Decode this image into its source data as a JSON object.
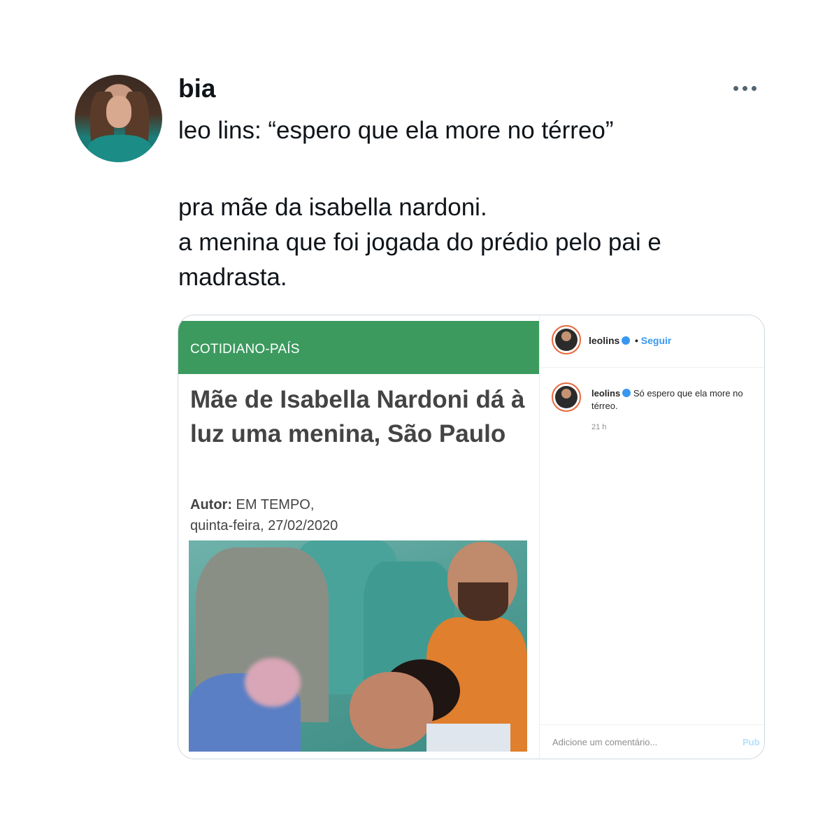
{
  "tweet": {
    "author_name": "bia",
    "lines": [
      "leo lins: “espero que ela more no térreo”",
      "pra mãe da isabella nardoni.",
      "a menina que foi jogada do prédio pelo pai e",
      "madrasta."
    ]
  },
  "article": {
    "section": "COTIDIANO-PAÍS",
    "headline": "Mãe de Isabella Nardoni dá à luz uma menina, São Paulo",
    "author_label": "Autor:",
    "author_value": " EM TEMPO,",
    "date": "quinta-feira, 27/02/2020"
  },
  "instagram": {
    "username": "leolins",
    "separator": "•",
    "follow_label": "Seguir",
    "caption": "Só espero que ela more no térreo.",
    "time": "21 h",
    "comment_placeholder": "Adicione um comentário...",
    "post_label": "Pub"
  },
  "colors": {
    "section_bar": "#3c9a5f",
    "headline": "#444444",
    "link_blue": "#3897f0"
  }
}
